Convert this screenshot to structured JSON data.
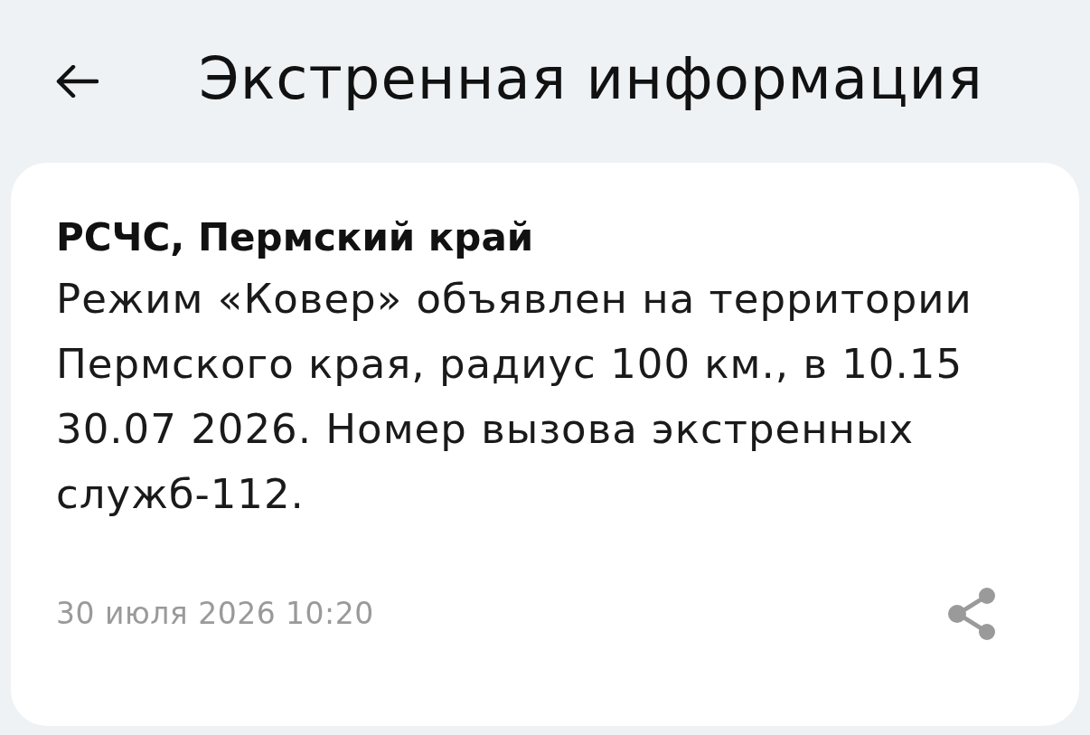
{
  "header": {
    "title": "Экстренная информация"
  },
  "alert": {
    "source": "РСЧС, Пермский край",
    "message": "Режим «Ковер» объявлен на территории Пермского края, радиус 100 км., в 10.15 30.07 2026. Номер вызова экстренных служб-112.",
    "timestamp": "30 июля 2026 10:20"
  }
}
